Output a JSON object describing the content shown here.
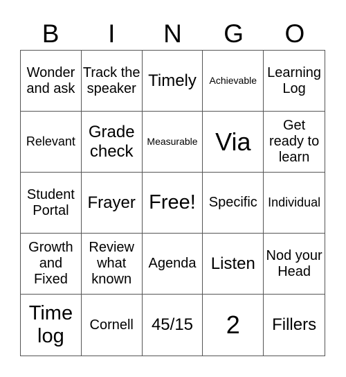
{
  "header": {
    "letters": [
      "B",
      "I",
      "N",
      "G",
      "O"
    ]
  },
  "cells": [
    {
      "text": "Wonder and ask",
      "size": "m"
    },
    {
      "text": "Track the speaker",
      "size": "m"
    },
    {
      "text": "Timely",
      "size": "l"
    },
    {
      "text": "Achievable",
      "size": "xs"
    },
    {
      "text": "Learning Log",
      "size": "m"
    },
    {
      "text": "Relevant",
      "size": "s"
    },
    {
      "text": "Grade check",
      "size": "l"
    },
    {
      "text": "Measurable",
      "size": "xs"
    },
    {
      "text": "Via",
      "size": "xxl"
    },
    {
      "text": "Get ready to learn",
      "size": "m"
    },
    {
      "text": "Student Portal",
      "size": "m"
    },
    {
      "text": "Frayer",
      "size": "l"
    },
    {
      "text": "Free!",
      "size": "xl"
    },
    {
      "text": "Specific",
      "size": "m"
    },
    {
      "text": "Individual",
      "size": "s"
    },
    {
      "text": "Growth and Fixed",
      "size": "m"
    },
    {
      "text": "Review what known",
      "size": "m"
    },
    {
      "text": "Agenda",
      "size": "m"
    },
    {
      "text": "Listen",
      "size": "l"
    },
    {
      "text": "Nod your Head",
      "size": "m"
    },
    {
      "text": "Time log",
      "size": "xl"
    },
    {
      "text": "Cornell",
      "size": "m"
    },
    {
      "text": "45/15",
      "size": "l"
    },
    {
      "text": "2",
      "size": "xxl"
    },
    {
      "text": "Fillers",
      "size": "l"
    }
  ]
}
